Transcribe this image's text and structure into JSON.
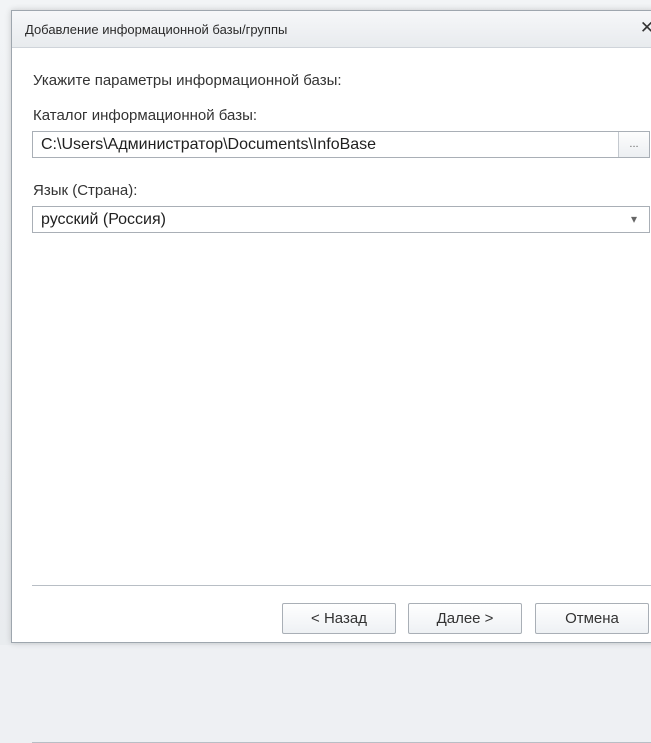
{
  "dialog": {
    "title": "Добавление информационной базы/группы",
    "close_symbol": "✕"
  },
  "form": {
    "heading": "Укажите параметры информационной базы:",
    "catalog_label": "Каталог информационной базы:",
    "catalog_value": "C:\\Users\\Администратор\\Documents\\InfoBase",
    "browse_label": "...",
    "language_label": "Язык (Страна):",
    "language_value": "русский (Россия)",
    "dropdown_symbol": "▾"
  },
  "buttons": {
    "back": "< Назад",
    "next": "Далее >",
    "cancel": "Отмена"
  }
}
